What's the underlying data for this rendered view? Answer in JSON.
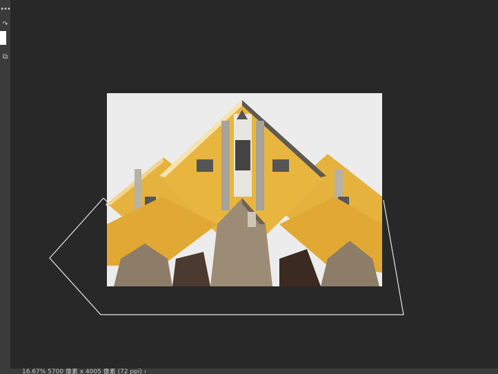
{
  "toolbar": {
    "tools": [
      {
        "name": "more-tools-icon",
        "glyph": "•••"
      },
      {
        "name": "swap-colors-icon",
        "glyph": "↷"
      },
      {
        "name": "screen-mode-icon",
        "glyph": "⧉"
      }
    ]
  },
  "document": {
    "status": "16.67%   5700 像素 x 4005 像素 (72 ppi)   ›"
  },
  "colors": {
    "workspace": "#282828",
    "panel": "#3b3b3b",
    "facade_yellow": "#e6b23e",
    "sky": "#ececec",
    "brick": "#9c8b75"
  }
}
